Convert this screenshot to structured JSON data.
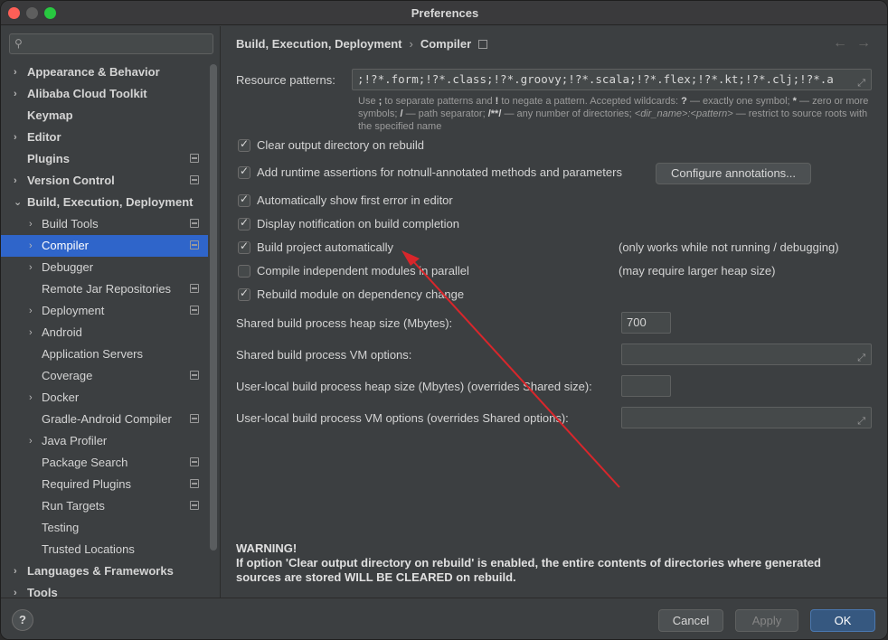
{
  "window": {
    "title": "Preferences"
  },
  "search": {
    "placeholder": ""
  },
  "sidebar": {
    "items": [
      {
        "label": "Appearance & Behavior",
        "bold": true,
        "arrow": "›",
        "indent": 0,
        "gear": false
      },
      {
        "label": "Alibaba Cloud Toolkit",
        "bold": true,
        "arrow": "›",
        "indent": 0,
        "gear": false
      },
      {
        "label": "Keymap",
        "bold": true,
        "arrow": "",
        "indent": 0,
        "gear": false
      },
      {
        "label": "Editor",
        "bold": true,
        "arrow": "›",
        "indent": 0,
        "gear": false
      },
      {
        "label": "Plugins",
        "bold": true,
        "arrow": "",
        "indent": 0,
        "gear": true
      },
      {
        "label": "Version Control",
        "bold": true,
        "arrow": "›",
        "indent": 0,
        "gear": true
      },
      {
        "label": "Build, Execution, Deployment",
        "bold": true,
        "arrow": "⌄",
        "indent": 0,
        "gear": false
      },
      {
        "label": "Build Tools",
        "bold": false,
        "arrow": "›",
        "indent": 1,
        "gear": true
      },
      {
        "label": "Compiler",
        "bold": false,
        "arrow": "›",
        "indent": 1,
        "gear": true,
        "selected": true
      },
      {
        "label": "Debugger",
        "bold": false,
        "arrow": "›",
        "indent": 1,
        "gear": false
      },
      {
        "label": "Remote Jar Repositories",
        "bold": false,
        "arrow": "",
        "indent": 1,
        "gear": true
      },
      {
        "label": "Deployment",
        "bold": false,
        "arrow": "›",
        "indent": 1,
        "gear": true
      },
      {
        "label": "Android",
        "bold": false,
        "arrow": "›",
        "indent": 1,
        "gear": false
      },
      {
        "label": "Application Servers",
        "bold": false,
        "arrow": "",
        "indent": 1,
        "gear": false
      },
      {
        "label": "Coverage",
        "bold": false,
        "arrow": "",
        "indent": 1,
        "gear": true
      },
      {
        "label": "Docker",
        "bold": false,
        "arrow": "›",
        "indent": 1,
        "gear": false
      },
      {
        "label": "Gradle-Android Compiler",
        "bold": false,
        "arrow": "",
        "indent": 1,
        "gear": true
      },
      {
        "label": "Java Profiler",
        "bold": false,
        "arrow": "›",
        "indent": 1,
        "gear": false
      },
      {
        "label": "Package Search",
        "bold": false,
        "arrow": "",
        "indent": 1,
        "gear": true
      },
      {
        "label": "Required Plugins",
        "bold": false,
        "arrow": "",
        "indent": 1,
        "gear": true
      },
      {
        "label": "Run Targets",
        "bold": false,
        "arrow": "",
        "indent": 1,
        "gear": true
      },
      {
        "label": "Testing",
        "bold": false,
        "arrow": "",
        "indent": 1,
        "gear": false
      },
      {
        "label": "Trusted Locations",
        "bold": false,
        "arrow": "",
        "indent": 1,
        "gear": false
      },
      {
        "label": "Languages & Frameworks",
        "bold": true,
        "arrow": "›",
        "indent": 0,
        "gear": false
      },
      {
        "label": "Tools",
        "bold": true,
        "arrow": "›",
        "indent": 0,
        "gear": false
      }
    ]
  },
  "breadcrumb": {
    "parent": "Build, Execution, Deployment",
    "separator": "›",
    "current": "Compiler"
  },
  "nav": {
    "back": "←",
    "forward": "→"
  },
  "resource": {
    "label": "Resource patterns:",
    "value": ";!?*.form;!?*.class;!?*.groovy;!?*.scala;!?*.flex;!?*.kt;!?*.clj;!?*.a",
    "hint_1": "Use",
    "hint_semicolon": ";",
    "hint_2": "to separate patterns and",
    "hint_excl": "!",
    "hint_3": "to negate a pattern. Accepted wildcards:",
    "hint_q": "?",
    "hint_4": "— exactly one symbol;",
    "hint_star": "*",
    "hint_5": "— zero or more symbols;",
    "hint_slash": "/",
    "hint_6": "— path separator;",
    "hint_dstar": "/**/",
    "hint_7": "— any number of directories;",
    "hint_dirpat": "<dir_name>:<pattern>",
    "hint_8": "— restrict to source roots with the specified name"
  },
  "options": {
    "clear_output": {
      "label": "Clear output directory on rebuild",
      "checked": true
    },
    "runtime_assertions": {
      "label": "Add runtime assertions for notnull-annotated methods and parameters",
      "checked": true
    },
    "configure_annotations": "Configure annotations...",
    "show_first_error": {
      "label": "Automatically show first error in editor",
      "checked": true
    },
    "display_notification": {
      "label": "Display notification on build completion",
      "checked": true
    },
    "build_auto": {
      "label": "Build project automatically",
      "checked": true,
      "note": "(only works while not running / debugging)"
    },
    "compile_parallel": {
      "label": "Compile independent modules in parallel",
      "checked": false,
      "note": "(may require larger heap size)"
    },
    "rebuild_dependency": {
      "label": "Rebuild module on dependency change",
      "checked": true
    }
  },
  "settings": {
    "shared_heap_label": "Shared build process heap size (Mbytes):",
    "shared_heap_value": "700",
    "shared_vm_label": "Shared build process VM options:",
    "shared_vm_value": "",
    "user_heap_label": "User-local build process heap size (Mbytes) (overrides Shared size):",
    "user_heap_value": "",
    "user_vm_label": "User-local build process VM options (overrides Shared options):",
    "user_vm_value": ""
  },
  "warning": {
    "title": "WARNING!",
    "text": "If option 'Clear output directory on rebuild' is enabled, the entire contents of directories where generated sources are stored WILL BE CLEARED on rebuild."
  },
  "footer": {
    "help": "?",
    "cancel": "Cancel",
    "apply": "Apply",
    "ok": "OK"
  },
  "colors": {
    "accent": "#2f65ca",
    "annotation_arrow": "#d9262b",
    "ok_button": "#365880"
  }
}
